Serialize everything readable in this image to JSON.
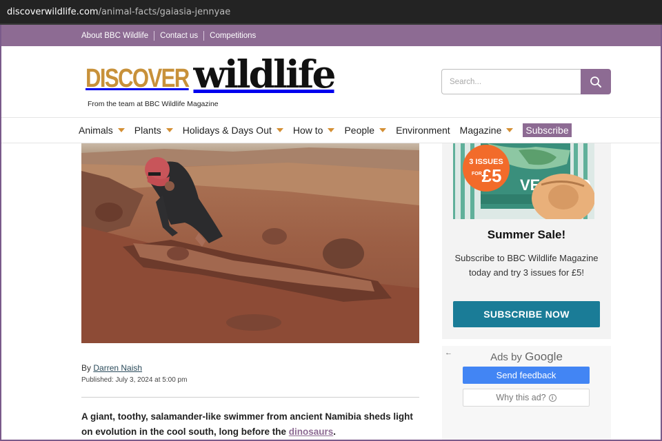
{
  "browser": {
    "url_host": "discoverwildlife.com",
    "url_path": "/animal-facts/gaiasia-jennyae"
  },
  "topbar": {
    "links": [
      "About BBC Wildlife",
      "Contact us",
      "Competitions"
    ]
  },
  "header": {
    "logo_part1": "DISCOVER",
    "logo_part2": "wildlife",
    "tagline": "From the team at BBC Wildlife Magazine",
    "search_placeholder": "Search..."
  },
  "nav": {
    "items": [
      {
        "label": "Animals",
        "dropdown": true
      },
      {
        "label": "Plants",
        "dropdown": true
      },
      {
        "label": "Holidays & Days Out",
        "dropdown": true
      },
      {
        "label": "How to",
        "dropdown": true
      },
      {
        "label": "People",
        "dropdown": true
      },
      {
        "label": "Environment",
        "dropdown": false
      },
      {
        "label": "Magazine",
        "dropdown": true
      }
    ],
    "subscribe": "Subscribe"
  },
  "article": {
    "by_prefix": "By",
    "author": "Darren Naish",
    "published": "Published: July 3, 2024 at 5:00 pm",
    "lede_text": "A giant, toothy, salamander-like swimmer from ancient Namibia sheds light on evolution in the cool south, long before the",
    "lede_link": "dinosaurs",
    "lede_end": "."
  },
  "promo": {
    "badge_line1": "3 ISSUES",
    "badge_for": "FOR",
    "badge_price": "£5",
    "cover_text": "VE THE O",
    "title": "Summer Sale!",
    "text": "Subscribe to BBC Wildlife Magazine today and try 3 issues for £5!",
    "button": "SUBSCRIBE NOW"
  },
  "ad": {
    "back_arrow": "←",
    "ads_by": "Ads by",
    "google": "Google",
    "send_feedback": "Send feedback",
    "why_this_ad": "Why this ad?",
    "info_glyph": "i"
  },
  "colors": {
    "brand_purple": "#8d6b93",
    "logo_gold": "#c8913a",
    "cta_teal": "#1a7c97",
    "google_blue": "#4285f4"
  },
  "icons": {
    "search": "magnifier-icon",
    "dropdown": "caret-down-icon"
  }
}
